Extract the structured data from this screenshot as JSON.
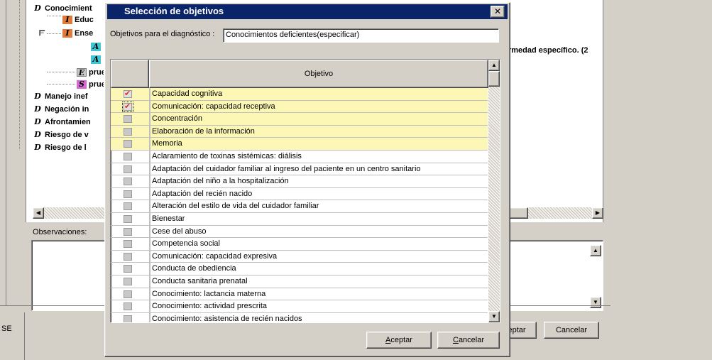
{
  "tree": {
    "items": [
      {
        "badge": "D",
        "label": "Conocimient"
      },
      {
        "badge": "I",
        "label": "Educ"
      },
      {
        "badge": "I",
        "label": "Ense"
      },
      {
        "badge": "A",
        "label": ""
      },
      {
        "badge": "A",
        "label": ""
      },
      {
        "badge": "E",
        "label": "prueb"
      },
      {
        "badge": "S",
        "label": "prueb"
      },
      {
        "badge": "D",
        "label": "Manejo inef"
      },
      {
        "badge": "D",
        "label": "Negación in"
      },
      {
        "badge": "D",
        "label": "Afrontamien"
      },
      {
        "badge": "D",
        "label": "Riesgo de v"
      },
      {
        "badge": "D",
        "label": "Riesgo de l"
      }
    ],
    "expand_symbol": "−",
    "right_text": "rmedad específico. (2"
  },
  "observaciones_label": "Observaciones:",
  "bg_buttons": {
    "accept": "eptar",
    "cancel": "Cancelar"
  },
  "se_label": "SE",
  "dialog": {
    "title": "Selección de objetivos",
    "close_glyph": "✕",
    "diagnosis_label": "Objetivos para el diagnóstico :",
    "diagnosis_value": "Conocimientos deficientes(especificar)",
    "column_header": "Objetivo",
    "rows": [
      {
        "label": "Capacidad cognitiva",
        "checked": true,
        "highlighted": true
      },
      {
        "label": "Comunicación: capacidad receptiva",
        "checked": true,
        "highlighted": true
      },
      {
        "label": "Concentración",
        "checked": false,
        "highlighted": true
      },
      {
        "label": "Elaboración de la información",
        "checked": false,
        "highlighted": true
      },
      {
        "label": "Memoria",
        "checked": false,
        "highlighted": true
      },
      {
        "label": "Aclaramiento de toxinas sistémicas: diálisis",
        "checked": false,
        "highlighted": false
      },
      {
        "label": "Adaptación del cuidador familiar al ingreso del paciente en un centro sanitario",
        "checked": false,
        "highlighted": false
      },
      {
        "label": "Adaptación del niño a la hospitalización",
        "checked": false,
        "highlighted": false
      },
      {
        "label": "Adaptación del recién nacido",
        "checked": false,
        "highlighted": false
      },
      {
        "label": "Alteración del estilo de vida del cuidador familiar",
        "checked": false,
        "highlighted": false
      },
      {
        "label": "Bienestar",
        "checked": false,
        "highlighted": false
      },
      {
        "label": "Cese del abuso",
        "checked": false,
        "highlighted": false
      },
      {
        "label": "Competencia social",
        "checked": false,
        "highlighted": false
      },
      {
        "label": "Comunicación: capacidad expresiva",
        "checked": false,
        "highlighted": false
      },
      {
        "label": "Conducta de obediencia",
        "checked": false,
        "highlighted": false
      },
      {
        "label": "Conducta sanitaria prenatal",
        "checked": false,
        "highlighted": false
      },
      {
        "label": "Conocimiento:  lactancia materna",
        "checked": false,
        "highlighted": false
      },
      {
        "label": "Conocimiento: actividad prescrita",
        "checked": false,
        "highlighted": false
      },
      {
        "label": "Conocimiento: asistencia de recién nacidos",
        "checked": false,
        "highlighted": false
      }
    ],
    "accept_prefix": "A",
    "accept_rest": "ceptar",
    "cancel_prefix": "C",
    "cancel_rest": "ancelar"
  },
  "colors": {
    "title_bar": "#0a246a",
    "highlight_row": "#fdf7b6",
    "check_mark": "#e03030"
  }
}
